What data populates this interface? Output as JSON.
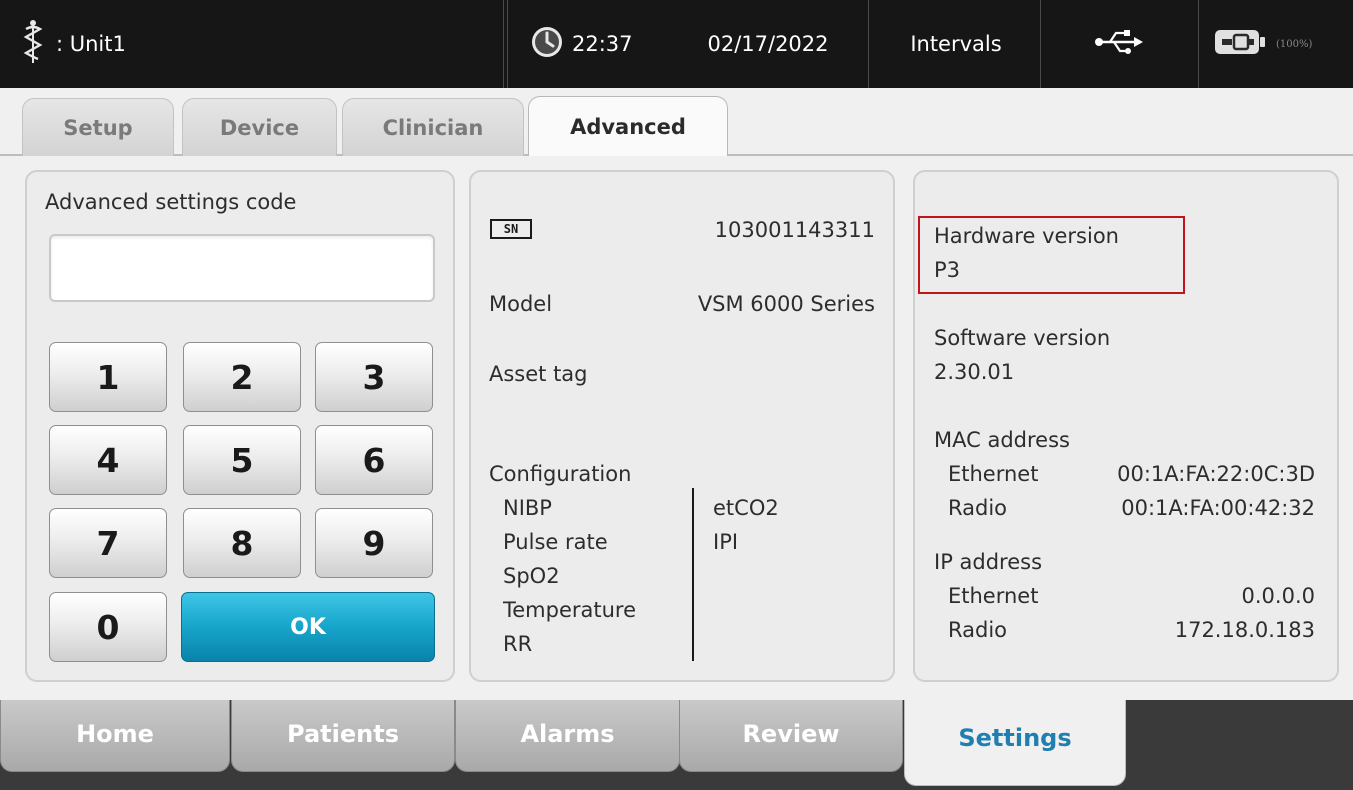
{
  "status_bar": {
    "unit_label": ": Unit1",
    "time": "22:37",
    "date": "02/17/2022",
    "intervals_label": "Intervals",
    "battery_percent": "(100%)",
    "icons": [
      "caduceus-icon",
      "clock-icon",
      "usb-icon",
      "battery-icon"
    ]
  },
  "tabs": [
    {
      "label": "Setup",
      "active": false
    },
    {
      "label": "Device",
      "active": false
    },
    {
      "label": "Clinician",
      "active": false
    },
    {
      "label": "Advanced",
      "active": true
    }
  ],
  "advanced_code": {
    "title": "Advanced settings code",
    "input_value": "",
    "keys": [
      "1",
      "2",
      "3",
      "4",
      "5",
      "6",
      "7",
      "8",
      "9",
      "0"
    ],
    "ok_label": "OK"
  },
  "device_info": {
    "sn_badge": "SN",
    "serial_number": "103001143311",
    "model_label": "Model",
    "model_value": "VSM 6000 Series",
    "asset_tag_label": "Asset tag",
    "configuration_label": "Configuration",
    "config_col1": [
      "NIBP",
      "Pulse rate",
      "SpO2",
      "Temperature",
      "RR"
    ],
    "config_col2": [
      "etCO2",
      "IPI"
    ]
  },
  "versions": {
    "hardware_label": "Hardware version",
    "hardware_value": "P3",
    "software_label": "Software version",
    "software_value": "2.30.01",
    "mac_label": "MAC address",
    "mac_ethernet_label": "Ethernet",
    "mac_ethernet_value": "00:1A:FA:22:0C:3D",
    "mac_radio_label": "Radio",
    "mac_radio_value": "00:1A:FA:00:42:32",
    "ip_label": "IP address",
    "ip_ethernet_label": "Ethernet",
    "ip_ethernet_value": "0.0.0.0",
    "ip_radio_label": "Radio",
    "ip_radio_value": "172.18.0.183"
  },
  "bottom_nav": [
    {
      "label": "Home",
      "active": false
    },
    {
      "label": "Patients",
      "active": false
    },
    {
      "label": "Alarms",
      "active": false
    },
    {
      "label": "Review",
      "active": false
    },
    {
      "label": "Settings",
      "active": true
    }
  ],
  "colors": {
    "accent_blue": "#1e7fb0",
    "ok_button": "#17a5cb",
    "highlight_red": "#c0151c",
    "topbar_bg": "#161616"
  }
}
